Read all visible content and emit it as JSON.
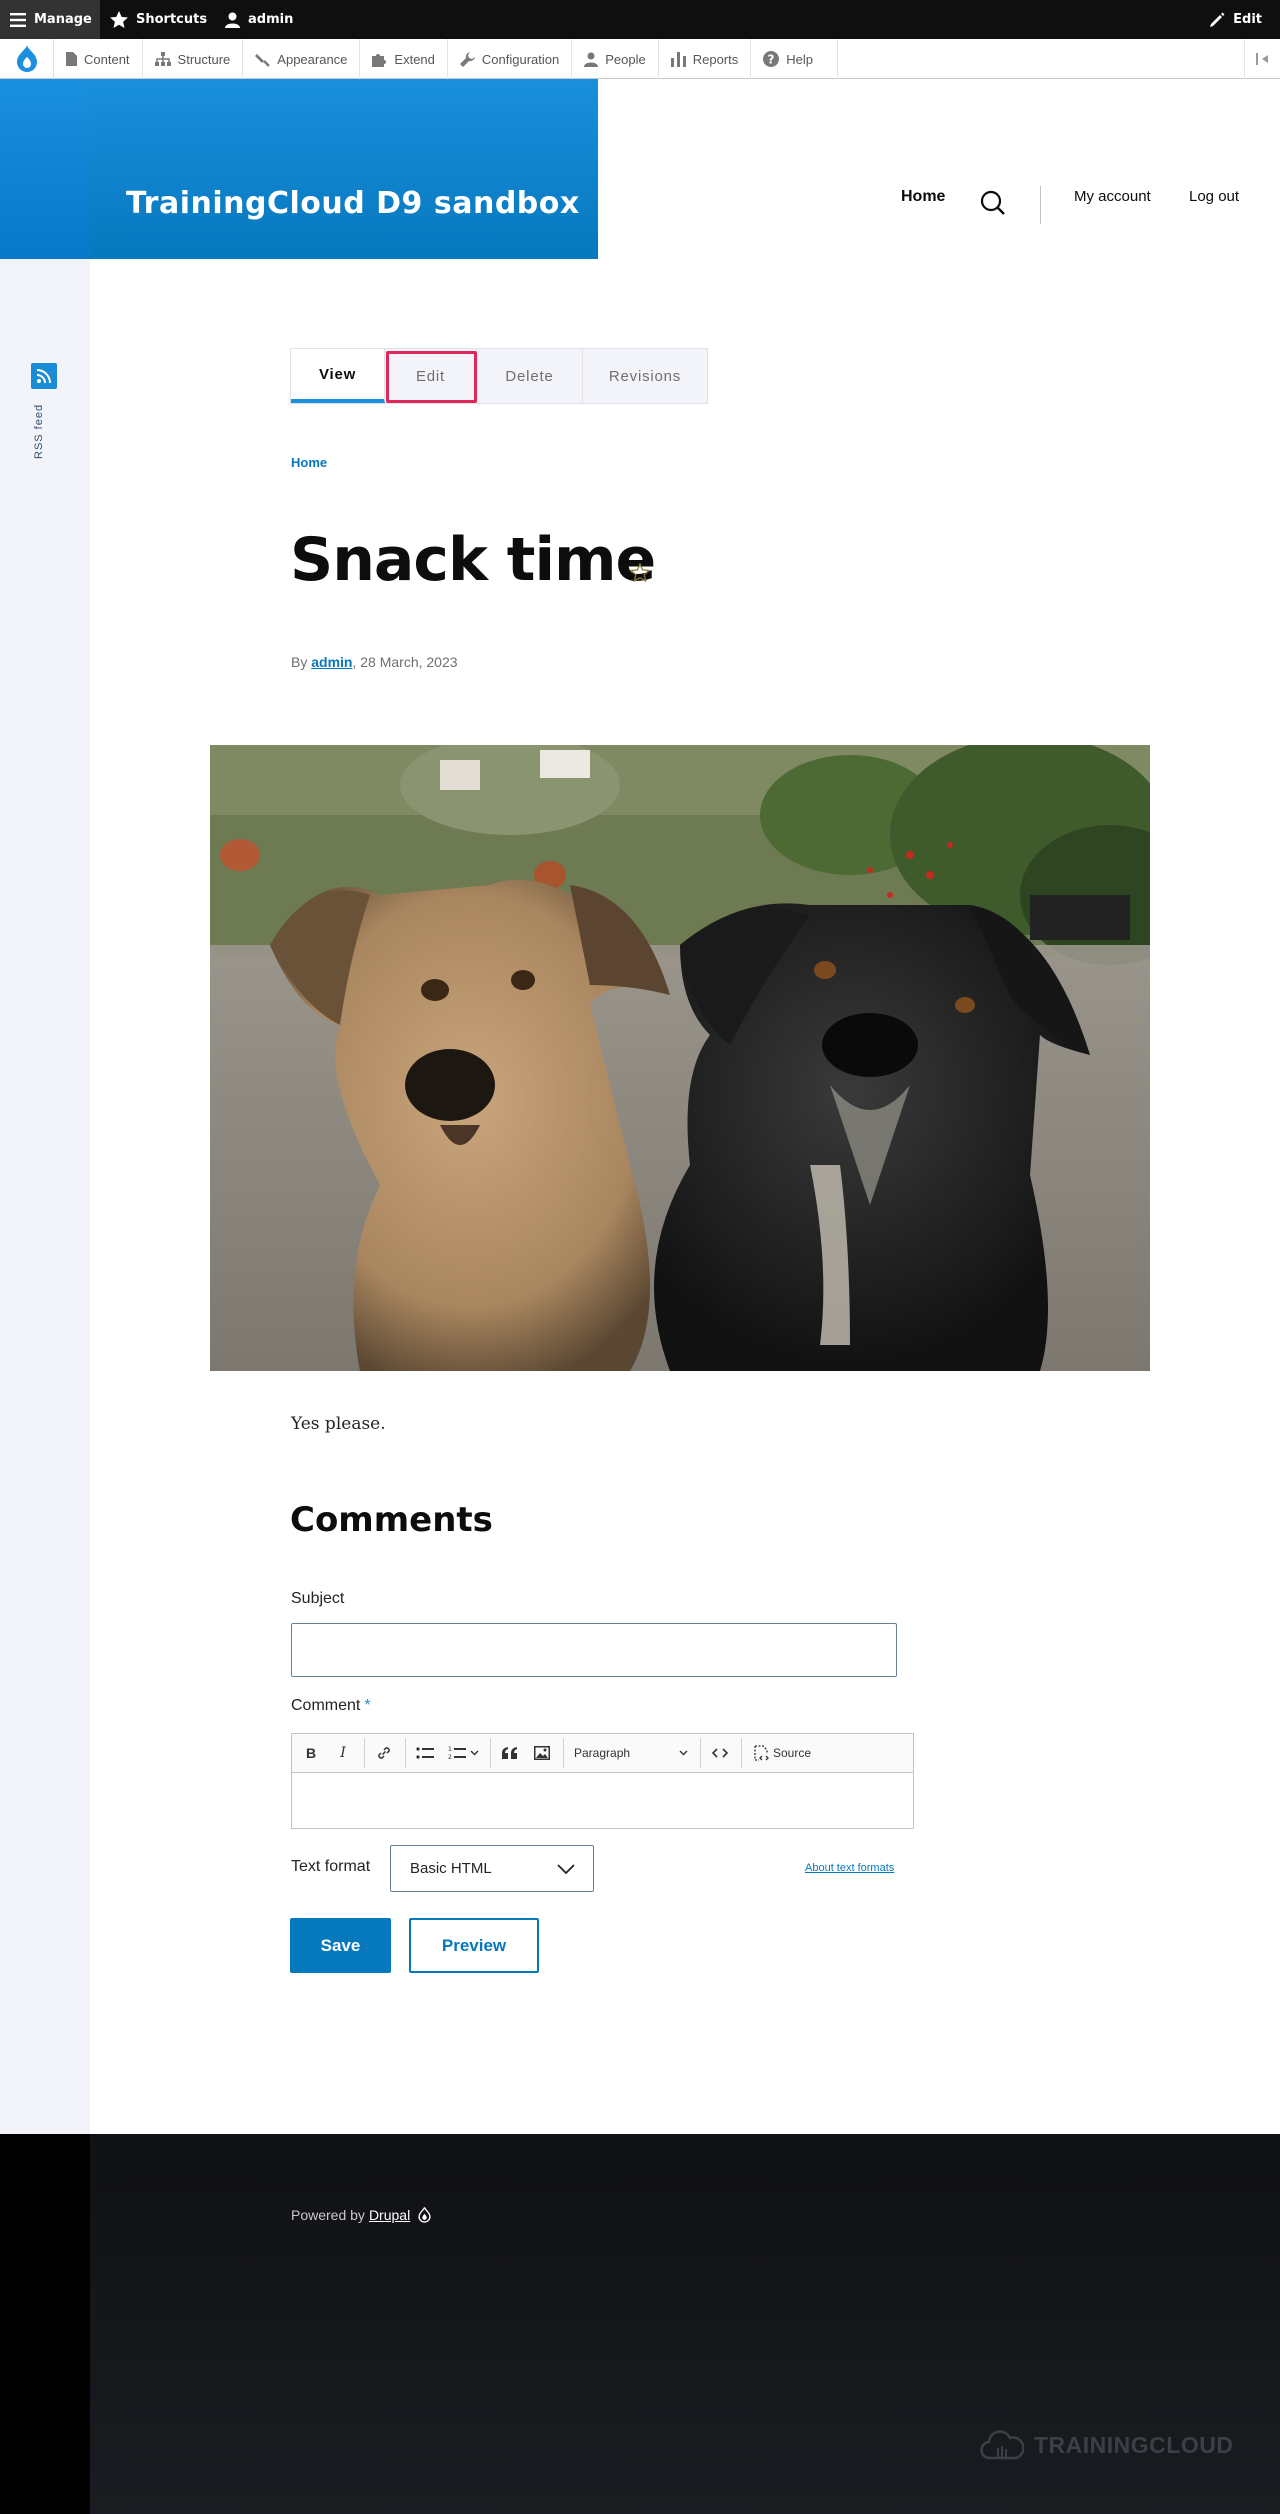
{
  "toolbar": {
    "manage": "Manage",
    "shortcuts": "Shortcuts",
    "user": "admin",
    "edit": "Edit"
  },
  "admin_menu": {
    "items": [
      {
        "label": "Content",
        "icon": "file-icon"
      },
      {
        "label": "Structure",
        "icon": "sitemap-icon"
      },
      {
        "label": "Appearance",
        "icon": "paint-roller-icon"
      },
      {
        "label": "Extend",
        "icon": "puzzle-icon"
      },
      {
        "label": "Configuration",
        "icon": "wrench-icon"
      },
      {
        "label": "People",
        "icon": "person-icon"
      },
      {
        "label": "Reports",
        "icon": "bar-chart-icon"
      },
      {
        "label": "Help",
        "icon": "question-icon"
      }
    ]
  },
  "site": {
    "name": "TrainingCloud D9 sandbox"
  },
  "main_nav": {
    "home": "Home",
    "my_account": "My account",
    "log_out": "Log out"
  },
  "social": {
    "rss_label": "RSS feed"
  },
  "tabs": {
    "view": "View",
    "edit": "Edit",
    "delete": "Delete",
    "revisions": "Revisions"
  },
  "breadcrumb": {
    "home": "Home"
  },
  "node": {
    "title": "Snack time",
    "by": "By",
    "author": "admin",
    "date": ", 28 March, 2023",
    "body": "Yes please."
  },
  "comments": {
    "title": "Comments",
    "subject_label": "Subject",
    "comment_label": "Comment",
    "required_marker": "*",
    "editor": {
      "bold": "B",
      "italic": "I",
      "paragraph": "Paragraph",
      "source": "Source"
    },
    "text_format_label": "Text format",
    "text_format_value": "Basic HTML",
    "about_formats": "About text formats",
    "save": "Save",
    "preview": "Preview"
  },
  "footer": {
    "powered_by": "Powered by",
    "drupal": "Drupal",
    "brand": "TRAININGCLOUD"
  },
  "colors": {
    "primary_blue": "#0678be",
    "highlight": "#e0275a"
  }
}
